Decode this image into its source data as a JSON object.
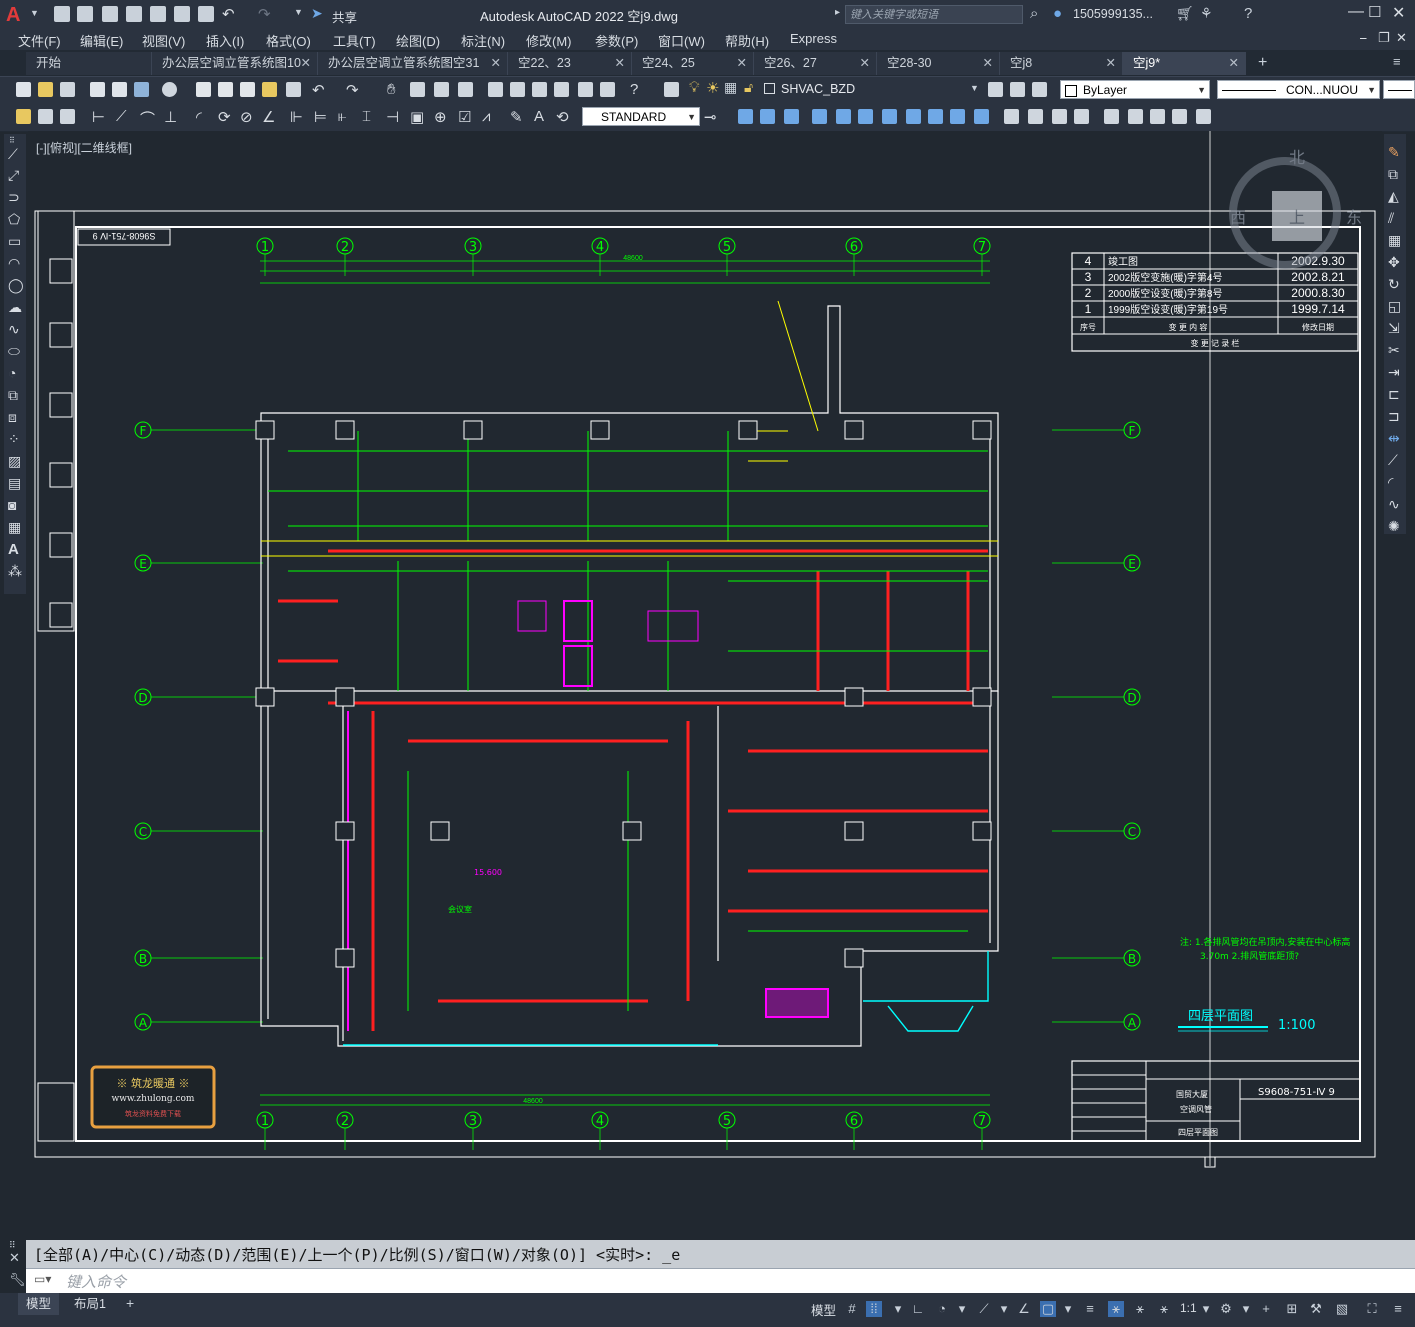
{
  "app": {
    "title": "Autodesk AutoCAD 2022    空j9.dwg",
    "logo": "A",
    "share_label": "共享",
    "search_placeholder": "键入关键字或短语",
    "user": "1505999135...",
    "window_controls": [
      "minimize",
      "restore",
      "close"
    ]
  },
  "menu": [
    "文件(F)",
    "编辑(E)",
    "视图(V)",
    "插入(I)",
    "格式(O)",
    "工具(T)",
    "绘图(D)",
    "标注(N)",
    "修改(M)",
    "参数(P)",
    "窗口(W)",
    "帮助(H)",
    "Express"
  ],
  "tabs": [
    {
      "label": "开始",
      "active": false,
      "closable": false
    },
    {
      "label": "办公层空调立管系统图10",
      "active": false,
      "closable": true
    },
    {
      "label": "办公层空调立管系统图空31",
      "active": false,
      "closable": true
    },
    {
      "label": "空22、23",
      "active": false,
      "closable": true
    },
    {
      "label": "空24、25",
      "active": false,
      "closable": true
    },
    {
      "label": "空26、27",
      "active": false,
      "closable": true
    },
    {
      "label": "空28-30",
      "active": false,
      "closable": true
    },
    {
      "label": "空j8",
      "active": false,
      "closable": true
    },
    {
      "label": "空j9*",
      "active": true,
      "closable": true
    }
  ],
  "toolbar": {
    "layer": "SHVAC_BZD",
    "color": "ByLayer",
    "linetype": "CON...NUOU",
    "textstyle": "STANDARD"
  },
  "viewport_label": "[-][俯视][二维线框]",
  "viewcube": {
    "n": "北",
    "w": "西",
    "e": "东",
    "top": "上"
  },
  "drawing": {
    "title_main": "四层平面图",
    "scale": "1:100",
    "sheet_no": "S9608-751-Ⅳ 9",
    "sheet_no_rotated": "S9608-751-Ⅳ 9",
    "revisions": [
      {
        "no": "4",
        "desc": "竣工图",
        "date": "2002.9.30"
      },
      {
        "no": "3",
        "desc": "2002版空变施(暖)字第4号",
        "date": "2002.8.21"
      },
      {
        "no": "2",
        "desc": "2000版空设变(暖)字第8号",
        "date": "2000.8.30"
      },
      {
        "no": "1",
        "desc": "1999版空设变(暖)字第19号",
        "date": "1999.7.14"
      }
    ],
    "rev_header": {
      "no": "序号",
      "desc": "变 更 内 容",
      "date": "修改日期"
    },
    "rev_footer": "变 更 记 录 栏",
    "grid_cols": [
      "1",
      "2",
      "3",
      "4",
      "5",
      "6",
      "7"
    ],
    "grid_rows": [
      "F",
      "E",
      "D",
      "C",
      "B",
      "A"
    ],
    "top_total_dim": "48600",
    "bottom_total_dim": "48600",
    "note_line1": "注:  1.各排风管均在吊顶内,安装在中心标高",
    "note_line2": "3.70m         2.排风管底距顶?",
    "watermark_line1": "※ 筑龙暖通 ※",
    "watermark_line2": "www.zhulong.com",
    "watermark_line3": "筑龙资料免费下载",
    "title_block": {
      "project": "国贸大厦",
      "system": "空调风管",
      "sheet_name": "四层平面图",
      "no": "S9608-751-Ⅳ 9"
    },
    "room_label": "会议室",
    "elev_label": "15.600"
  },
  "command": {
    "history": "[全部(A)/中心(C)/动态(D)/范围(E)/上一个(P)/比例(S)/窗口(W)/对象(O)] <实时>: _e",
    "placeholder": "键入命令"
  },
  "status": {
    "layout_tabs": [
      "模型",
      "布局1"
    ],
    "model_label": "模型",
    "scale": "1:1"
  }
}
